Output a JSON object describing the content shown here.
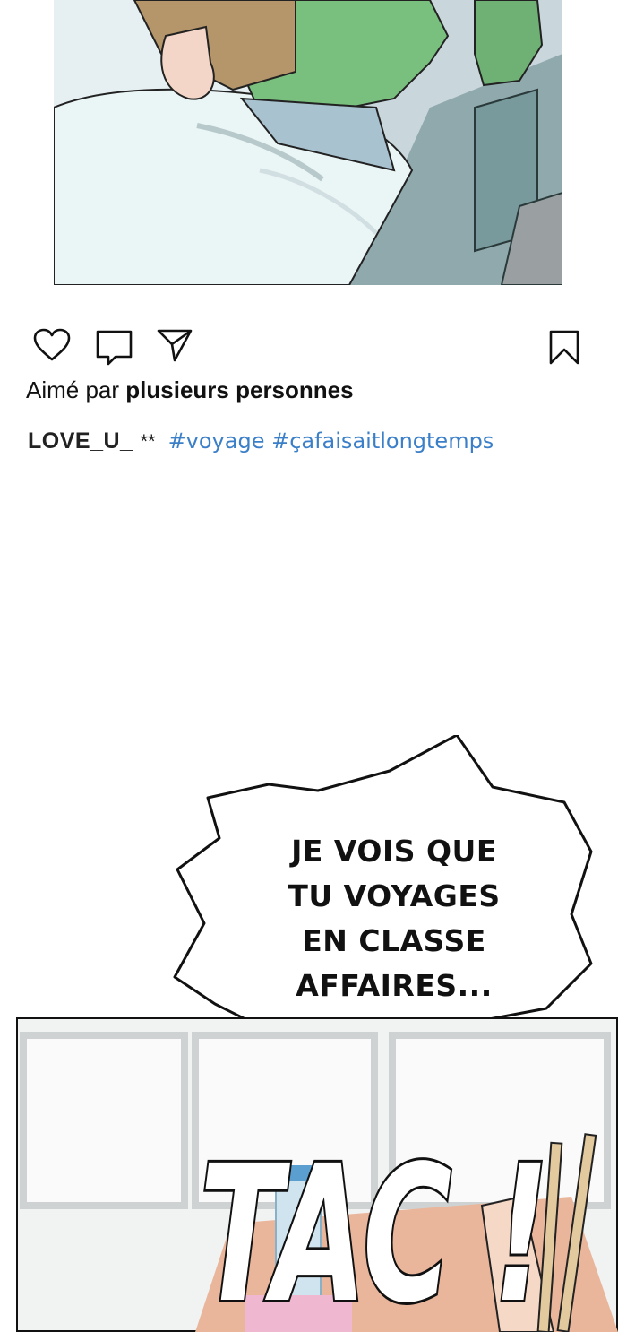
{
  "post": {
    "liked_prefix": "Aimé par",
    "liked_by": "plusieurs personnes",
    "username": "LOVE_U_",
    "stars": "**",
    "hashtags": "#voyage #çafaisaitlongtemps"
  },
  "icons": {
    "like": "heart-icon",
    "comment": "comment-icon",
    "share": "send-icon",
    "save": "bookmark-icon"
  },
  "colors": {
    "hashtag": "#3a7fc8",
    "text": "#111111"
  },
  "speech_bubble": {
    "lines": [
      "JE VOIS QUE",
      "TU VOYAGES",
      "EN CLASSE",
      "AFFAIRES..."
    ]
  },
  "sound_effect": {
    "text": "TAC !"
  }
}
